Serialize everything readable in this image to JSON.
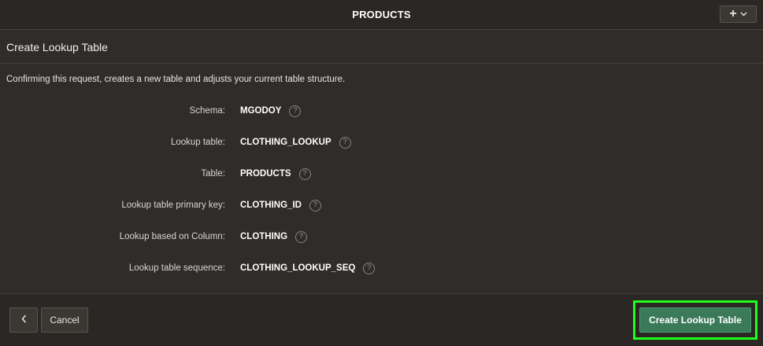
{
  "header": {
    "title": "PRODUCTS",
    "add_icon": "plus-icon",
    "add_menu_icon": "chevron-down-icon"
  },
  "dialog": {
    "title": "Create Lookup Table",
    "description": "Confirming this request, creates a new table and adjusts your current table structure.",
    "fields": [
      {
        "label": "Schema:",
        "value": "MGODOY"
      },
      {
        "label": "Lookup table:",
        "value": "CLOTHING_LOOKUP"
      },
      {
        "label": "Table:",
        "value": "PRODUCTS"
      },
      {
        "label": "Lookup table primary key:",
        "value": "CLOTHING_ID"
      },
      {
        "label": "Lookup based on Column:",
        "value": "CLOTHING"
      },
      {
        "label": "Lookup table sequence:",
        "value": "CLOTHING_LOOKUP_SEQ"
      }
    ],
    "help_glyph": "?"
  },
  "footer": {
    "back_icon": "chevron-left-icon",
    "cancel_label": "Cancel",
    "create_label": "Create Lookup Table"
  },
  "colors": {
    "background": "#2f2c29",
    "primary_button": "#3a7a58",
    "highlight": "#20ff1a"
  }
}
